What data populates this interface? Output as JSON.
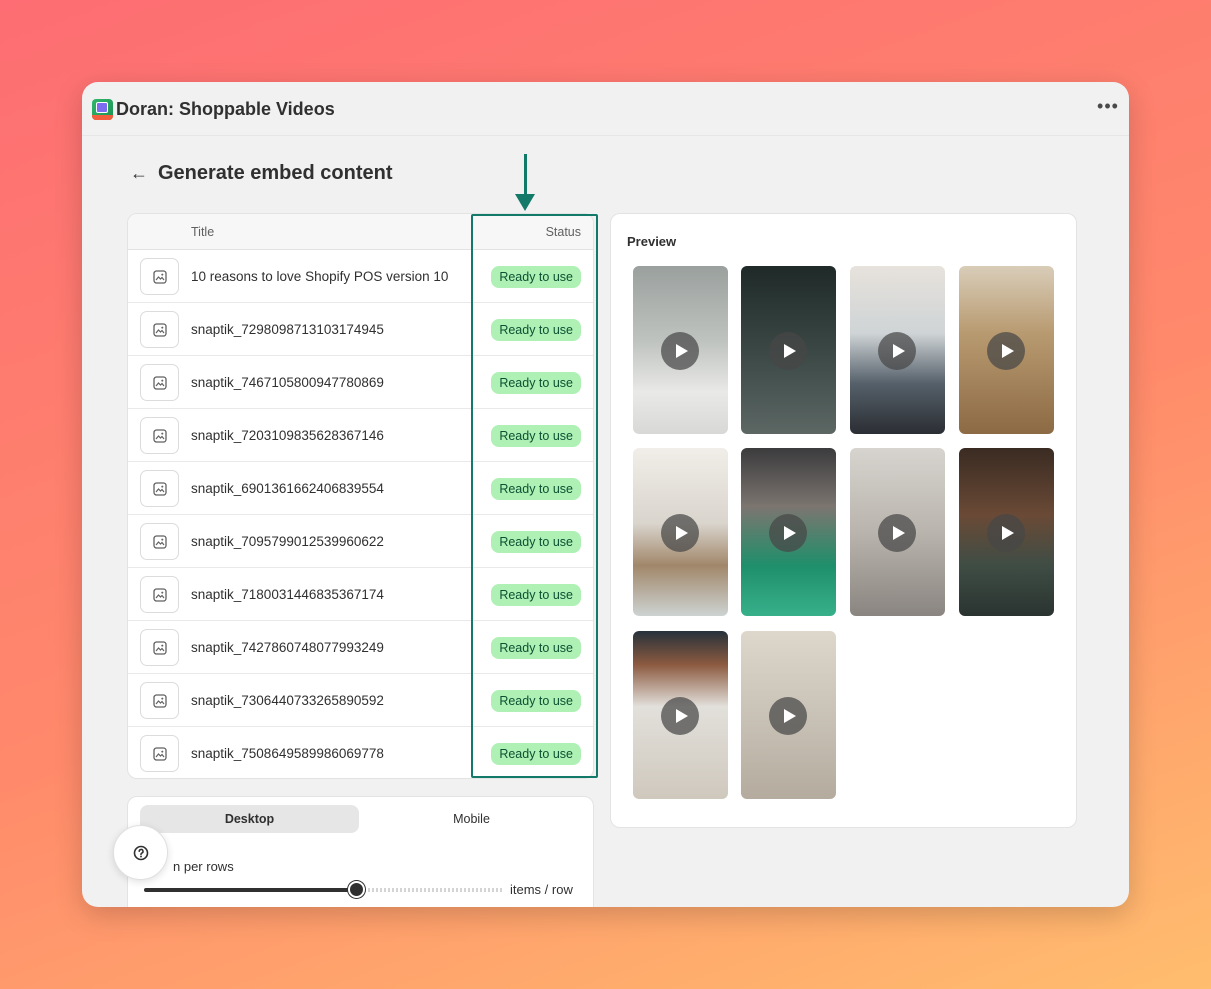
{
  "app": {
    "title": "Doran: Shoppable Videos",
    "more_label": "•••"
  },
  "page": {
    "back_label": "←",
    "title": "Generate embed content"
  },
  "table": {
    "headers": {
      "title": "Title",
      "status": "Status"
    },
    "rows": [
      {
        "title": "10 reasons to love Shopify POS version 10",
        "status": "Ready to use"
      },
      {
        "title": "snaptik_7298098713103174945",
        "status": "Ready to use"
      },
      {
        "title": "snaptik_7467105800947780869",
        "status": "Ready to use"
      },
      {
        "title": "snaptik_7203109835628367146",
        "status": "Ready to use"
      },
      {
        "title": "snaptik_6901361662406839554",
        "status": "Ready to use"
      },
      {
        "title": "snaptik_7095799012539960622",
        "status": "Ready to use"
      },
      {
        "title": "snaptik_7180031446835367174",
        "status": "Ready to use"
      },
      {
        "title": "snaptik_7427860748077993249",
        "status": "Ready to use"
      },
      {
        "title": "snaptik_7306440733265890592",
        "status": "Ready to use"
      },
      {
        "title": "snaptik_7508649589986069778",
        "status": "Ready to use"
      }
    ]
  },
  "preview": {
    "label": "Preview",
    "tiles": [
      {
        "bg": "linear-gradient(180deg,#9aa09d 0%,#bfc3c0 45%,#e9e9e7 75%,#d8d8d6 100%)"
      },
      {
        "bg": "linear-gradient(180deg,#1f2a28 0%,#3a4744 50%,#5c6764 100%)"
      },
      {
        "bg": "linear-gradient(180deg,#e7e2dc 0%,#cfd4d6 40%,#55606a 70%,#2b2e33 100%)"
      },
      {
        "bg": "linear-gradient(180deg,#d9cdb9 0%,#b89a70 40%,#8c6a44 100%)"
      },
      {
        "bg": "linear-gradient(180deg,#f1eee9 0%,#d9d4cc 45%,#a1876a 70%,#cdd3d2 100%)"
      },
      {
        "bg": "linear-gradient(180deg,#3b3b3d 0%,#7c7570 35%,#1f8f6b 70%,#37b08a 100%)"
      },
      {
        "bg": "linear-gradient(180deg,#d7d4cf 0%,#b9b4ad 50%,#8a8580 100%)"
      },
      {
        "bg": "linear-gradient(180deg,#3a2b22 0%,#6a4a36 40%,#3f4d45 70%,#2a3330 100%)"
      },
      {
        "bg": "linear-gradient(180deg,#27313b 0%,#8c5a40 20%,#e2e0db 45%,#cfc8bd 100%)"
      },
      {
        "bg": "linear-gradient(180deg,#ddd7cc 0%,#c9c2b6 50%,#b4ab9e 100%)"
      }
    ]
  },
  "layout_settings": {
    "tabs": [
      "Desktop",
      "Mobile"
    ],
    "active_tab": "Desktop",
    "per_rows_label": "n per rows",
    "slider_unit": "items / row"
  },
  "help": {
    "icon": "question-circle-icon"
  },
  "colors": {
    "highlight": "#137a6a",
    "badge_bg": "#aff0b5",
    "badge_text": "#0c5132"
  }
}
